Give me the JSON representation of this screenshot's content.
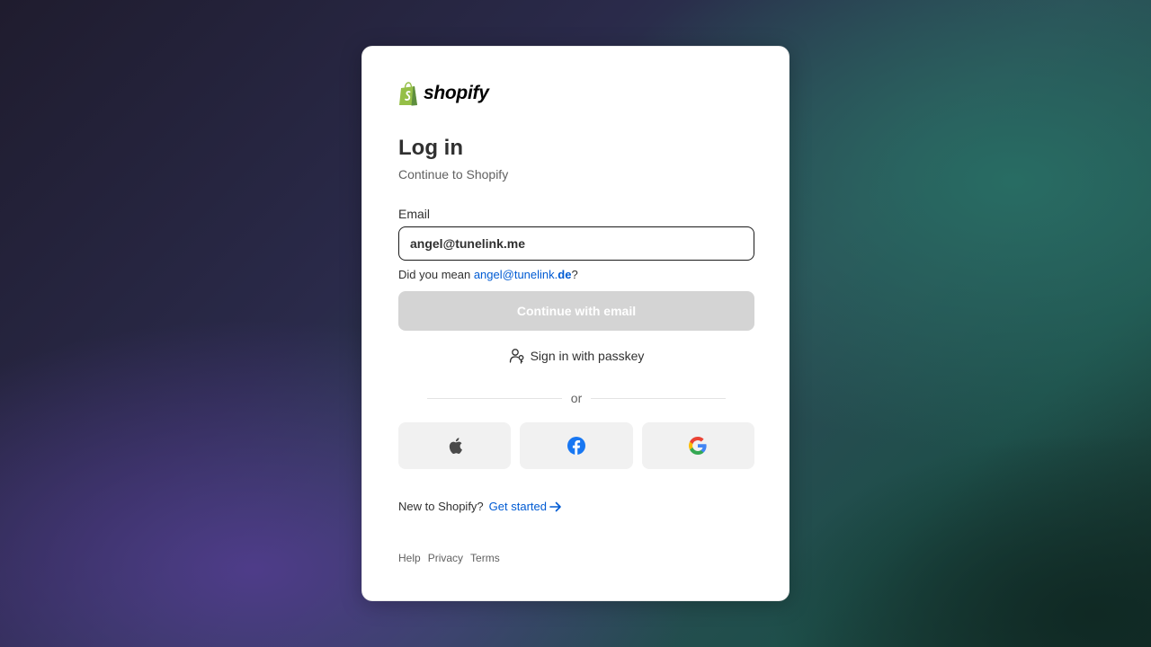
{
  "brand": {
    "name": "shopify",
    "logo_color": "#95bf47"
  },
  "login": {
    "title": "Log in",
    "subtitle": "Continue to Shopify",
    "email_label": "Email",
    "email_value": "angel@tunelink.me",
    "suggestion_prefix": "Did you mean ",
    "suggestion_local": "angel@tunelink.",
    "suggestion_domain": "de",
    "suggestion_suffix": "?",
    "continue_label": "Continue with email",
    "passkey_label": "Sign in with passkey",
    "divider_text": "or"
  },
  "social_buttons": [
    {
      "name": "apple",
      "icon": "apple-icon"
    },
    {
      "name": "facebook",
      "icon": "facebook-icon"
    },
    {
      "name": "google",
      "icon": "google-icon"
    }
  ],
  "signup": {
    "prompt": "New to Shopify?",
    "link_label": "Get started",
    "link_icon": "arrow-right-icon"
  },
  "footer": {
    "help": "Help",
    "privacy": "Privacy",
    "terms": "Terms"
  },
  "colors": {
    "accent_link": "#005bd3",
    "disabled_button": "#d4d4d4",
    "text_primary": "#303030",
    "text_secondary": "#616161"
  }
}
